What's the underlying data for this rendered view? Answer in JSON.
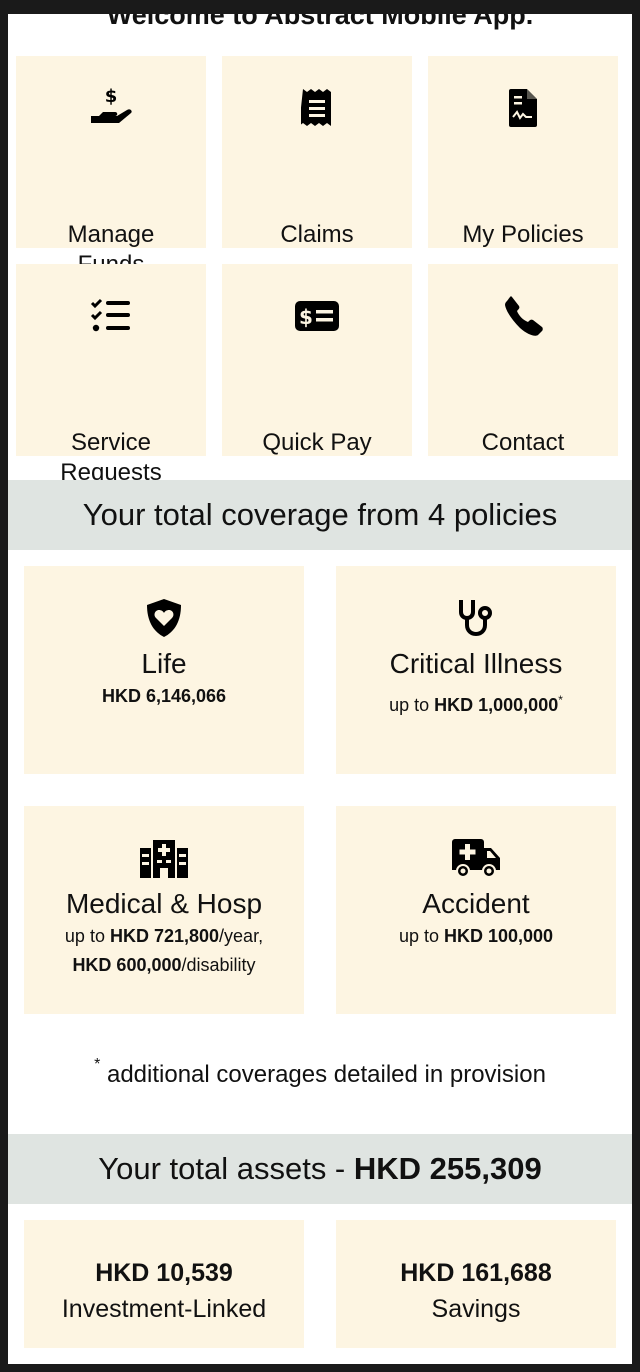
{
  "header": {
    "welcome": "Welcome to Abstract Mobile App."
  },
  "quick_actions": [
    {
      "label": "Manage Funds",
      "icon": "hand-dollar-icon"
    },
    {
      "label": "Claims",
      "icon": "receipt-icon"
    },
    {
      "label": "My Policies",
      "icon": "policy-document-icon"
    },
    {
      "label": "Service Requests",
      "icon": "checklist-icon"
    },
    {
      "label": "Quick Pay",
      "icon": "payment-card-icon"
    },
    {
      "label": "Contact",
      "icon": "phone-icon"
    }
  ],
  "coverage": {
    "heading": "Your total coverage from 4 policies",
    "life": {
      "title": "Life",
      "amount": "HKD 6,146,066",
      "icon": "shield-heart-icon"
    },
    "critical": {
      "title": "Critical Illness",
      "prefix": "up to ",
      "amount": "HKD 1,000,000",
      "mark": "*",
      "icon": "stethoscope-icon"
    },
    "medical": {
      "title": "Medical & Hosp",
      "prefix": "up to ",
      "amount1": "HKD 721,800",
      "suffix1": "/year,",
      "amount2": "HKD 600,000",
      "suffix2": "/disability",
      "icon": "hospital-icon"
    },
    "accident": {
      "title": "Accident",
      "prefix": "up to ",
      "amount": "HKD 100,000",
      "icon": "ambulance-icon"
    },
    "footnote_mark": "*",
    "footnote": "additional coverages detailed in provision"
  },
  "assets": {
    "heading_prefix": "Your total assets - ",
    "total": "HKD 255,309",
    "items": [
      {
        "amount": "HKD 10,539",
        "name": "Investment-Linked"
      },
      {
        "amount": "HKD 161,688",
        "name": "Savings"
      }
    ]
  },
  "colors": {
    "tile_bg": "#fdf5e2",
    "band_bg": "#dfe4e1",
    "frame": "#1a1a1a"
  }
}
